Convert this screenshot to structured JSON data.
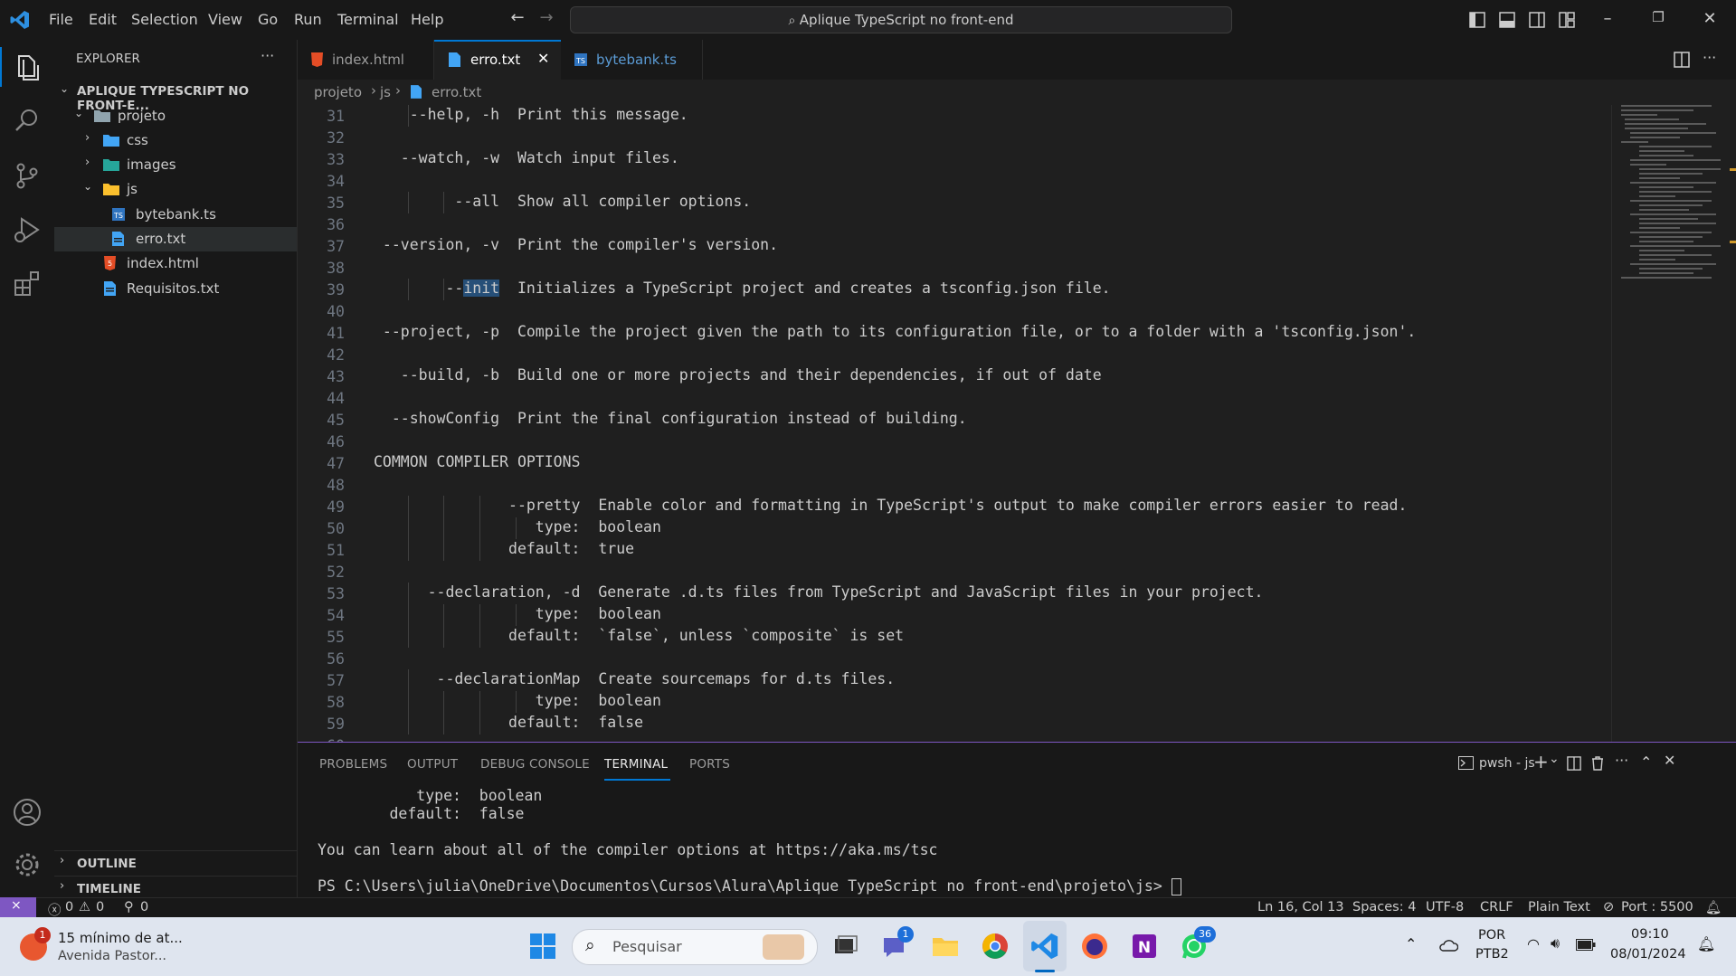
{
  "titlebar": {
    "menu": [
      "File",
      "Edit",
      "Selection",
      "View",
      "Go",
      "Run",
      "Terminal",
      "Help"
    ],
    "search_text": "Aplique TypeScript no front-end"
  },
  "sidebar": {
    "title": "EXPLORER",
    "more": "···",
    "root": "APLIQUE TYPESCRIPT NO FRONT-E...",
    "tree": [
      {
        "label": "projeto",
        "type": "folder-open"
      },
      {
        "label": "css",
        "type": "folder"
      },
      {
        "label": "images",
        "type": "folder"
      },
      {
        "label": "js",
        "type": "folder-open"
      },
      {
        "label": "bytebank.ts",
        "type": "ts"
      },
      {
        "label": "erro.txt",
        "type": "txt"
      },
      {
        "label": "index.html",
        "type": "html"
      },
      {
        "label": "Requisitos.txt",
        "type": "txt"
      }
    ],
    "outline": "OUTLINE",
    "timeline": "TIMELINE"
  },
  "tabs": [
    {
      "label": "index.html",
      "active": false
    },
    {
      "label": "erro.txt",
      "active": true
    },
    {
      "label": "bytebank.ts",
      "active": false
    }
  ],
  "breadcrumb": [
    "projeto",
    "js",
    "erro.txt"
  ],
  "editor": {
    "lines": [
      {
        "n": "31",
        "pre": "    --help, -h  Print this message.",
        "hl": "",
        "post": ""
      },
      {
        "n": "32",
        "pre": "",
        "hl": "",
        "post": ""
      },
      {
        "n": "33",
        "pre": "   --watch, -w  Watch input files.",
        "hl": "",
        "post": ""
      },
      {
        "n": "34",
        "pre": "",
        "hl": "",
        "post": ""
      },
      {
        "n": "35",
        "pre": "         --all  Show all compiler options.",
        "hl": "",
        "post": ""
      },
      {
        "n": "36",
        "pre": "",
        "hl": "",
        "post": ""
      },
      {
        "n": "37",
        "pre": " --version, -v  Print the compiler's version.",
        "hl": "",
        "post": ""
      },
      {
        "n": "38",
        "pre": "",
        "hl": "",
        "post": ""
      },
      {
        "n": "39",
        "pre": "        --",
        "hl": "init",
        "post": "  Initializes a TypeScript project and creates a tsconfig.json file."
      },
      {
        "n": "40",
        "pre": "",
        "hl": "",
        "post": ""
      },
      {
        "n": "41",
        "pre": " --project, -p  Compile the project given the path to its configuration file, or to a folder with a 'tsconfig.json'.",
        "hl": "",
        "post": ""
      },
      {
        "n": "42",
        "pre": "",
        "hl": "",
        "post": ""
      },
      {
        "n": "43",
        "pre": "   --build, -b  Build one or more projects and their dependencies, if out of date",
        "hl": "",
        "post": ""
      },
      {
        "n": "44",
        "pre": "",
        "hl": "",
        "post": ""
      },
      {
        "n": "45",
        "pre": "  --showConfig  Print the final configuration instead of building.",
        "hl": "",
        "post": ""
      },
      {
        "n": "46",
        "pre": "",
        "hl": "",
        "post": ""
      },
      {
        "n": "47",
        "pre": "COMMON COMPILER OPTIONS",
        "hl": "",
        "post": ""
      },
      {
        "n": "48",
        "pre": "",
        "hl": "",
        "post": ""
      },
      {
        "n": "49",
        "pre": "               --pretty  Enable color and formatting in TypeScript's output to make compiler errors easier to read.",
        "hl": "",
        "post": ""
      },
      {
        "n": "50",
        "pre": "                  type:  boolean",
        "hl": "",
        "post": ""
      },
      {
        "n": "51",
        "pre": "               default:  true",
        "hl": "",
        "post": ""
      },
      {
        "n": "52",
        "pre": "",
        "hl": "",
        "post": ""
      },
      {
        "n": "53",
        "pre": "      --declaration, -d  Generate .d.ts files from TypeScript and JavaScript files in your project.",
        "hl": "",
        "post": ""
      },
      {
        "n": "54",
        "pre": "                  type:  boolean",
        "hl": "",
        "post": ""
      },
      {
        "n": "55",
        "pre": "               default:  `false`, unless `composite` is set",
        "hl": "",
        "post": ""
      },
      {
        "n": "56",
        "pre": "",
        "hl": "",
        "post": ""
      },
      {
        "n": "57",
        "pre": "       --declarationMap  Create sourcemaps for d.ts files.",
        "hl": "",
        "post": ""
      },
      {
        "n": "58",
        "pre": "                  type:  boolean",
        "hl": "",
        "post": ""
      },
      {
        "n": "59",
        "pre": "               default:  false",
        "hl": "",
        "post": ""
      },
      {
        "n": "60",
        "pre": "",
        "hl": "",
        "post": ""
      }
    ]
  },
  "panel": {
    "tabs": [
      "PROBLEMS",
      "OUTPUT",
      "DEBUG CONSOLE",
      "TERMINAL",
      "PORTS"
    ],
    "active_tab": "TERMINAL",
    "terminal_name": "pwsh - js",
    "lines": [
      "           type:  boolean",
      "        default:  false",
      "",
      "You can learn about all of the compiler options at https://aka.ms/tsc",
      "",
      "PS C:\\Users\\julia\\OneDrive\\Documentos\\Cursos\\Alura\\Aplique TypeScript no front-end\\projeto\\js> "
    ]
  },
  "statusbar": {
    "errors": "0",
    "warnings": "0",
    "ports": "0",
    "position": "Ln 16, Col 13",
    "spaces": "Spaces: 4",
    "encoding": "UTF-8",
    "eol": "CRLF",
    "language": "Plain Text",
    "port": "Port : 5500"
  },
  "taskbar": {
    "weather_badge": "1",
    "weather_title": "15 mínimo de at...",
    "weather_sub": "Avenida Pastor...",
    "search_placeholder": "Pesquisar",
    "teams_badge": "1",
    "whatsapp_badge": "36",
    "lang_1": "POR",
    "lang_2": "PTB2",
    "time": "09:10",
    "date": "08/01/2024"
  },
  "colors": {
    "accent": "#0078d4",
    "panel_border": "#7e57c2",
    "selection": "#264f78"
  }
}
